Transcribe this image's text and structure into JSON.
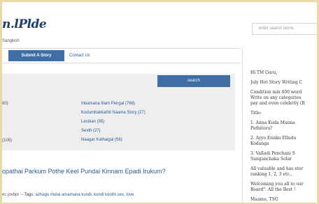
{
  "site": {
    "logo": "n.lPlde",
    "tagline": "Sangkish"
  },
  "search": {
    "placeholder": "enter search terms"
  },
  "nav": {
    "submit": "Submit A Story",
    "contact": "Contact Us"
  },
  "filter": {
    "search_button": "search",
    "left_labels": [
      "80)",
      "(109)"
    ],
    "categories": [
      "Inbamana Illam Pengal (768)",
      "Kodumbakkathil Naama Story (27)",
      "Lesbian (95)",
      "Sexth (27)",
      "Naagar Kathaigal (56)"
    ]
  },
  "post": {
    "title": "opathai Parkum Pothe Keel Pundai Kinnam Epadi Irukum?",
    "date_fragment": "ec jovbpr",
    "tags_label": "Tags:",
    "tags": "azhagu mulai amamana kundi, kundi koothi sex, love"
  },
  "sidebar": {
    "lines": [
      "Hi TM Guru,",
      "July Hot Story Writing C",
      "Condition mix 400 word",
      " Write on any categories",
      "pay and even celebrity (R",
      "Title:",
      "1.   Anna Kuda Manna",
      "Pathitoru?",
      "2.   Ayyo Ennku Ellndu",
      "Kodanga",
      "3.   Valladi Penchani S",
      "Sunganchaka Solar",
      " All valuable and has stor",
      "ranking 1, 2, 3 etc.,",
      "Welcoming you all to our",
      "Board\". All the Best !",
      "Maamu, TSG"
    ]
  },
  "colors": {
    "accent": "#3e6ea3",
    "link": "#2a5a96",
    "border": "#e9d9a8",
    "panel": "#eeeeee"
  }
}
